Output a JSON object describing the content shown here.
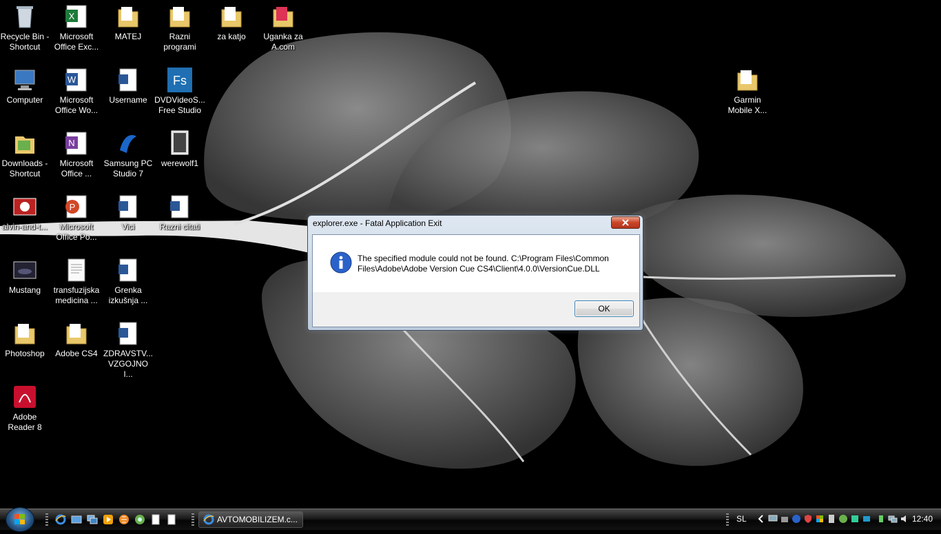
{
  "desktop": {
    "icons": [
      {
        "label": "Recycle Bin - Shortcut",
        "icon": "recycle-bin-icon"
      },
      {
        "label": "Microsoft Office Exc...",
        "icon": "excel-icon"
      },
      {
        "label": "MATEJ",
        "icon": "folder-icon"
      },
      {
        "label": "Razni programi",
        "icon": "folder-icon"
      },
      {
        "label": "za katjo",
        "icon": "folder-icon"
      },
      {
        "label": "Uganka za A.com",
        "icon": "folder-icon"
      },
      {
        "label": "Computer",
        "icon": "computer-icon"
      },
      {
        "label": "Microsoft Office Wo...",
        "icon": "word-icon"
      },
      {
        "label": "Username",
        "icon": "document-icon"
      },
      {
        "label": "DVDVideoS... Free Studio",
        "icon": "dvdvideosoft-icon"
      },
      {
        "label": "Garmin Mobile X...",
        "icon": "folder-icon"
      },
      {
        "label": "Downloads - Shortcut",
        "icon": "downloads-folder-icon"
      },
      {
        "label": "Microsoft Office ...",
        "icon": "onenote-icon"
      },
      {
        "label": "Samsung PC Studio 7",
        "icon": "samsung-pc-studio-icon"
      },
      {
        "label": "werewolf1",
        "icon": "image-file-icon"
      },
      {
        "label": "alvin-and-t...",
        "icon": "image-file-icon"
      },
      {
        "label": "Microsoft Office Po...",
        "icon": "powerpoint-icon"
      },
      {
        "label": "Vici",
        "icon": "document-icon"
      },
      {
        "label": "Razni citati",
        "icon": "document-icon"
      },
      {
        "label": "Mustang",
        "icon": "image-file-icon"
      },
      {
        "label": "transfuzijska medicina ...",
        "icon": "text-file-icon"
      },
      {
        "label": "Grenka izkušnja ...",
        "icon": "document-icon"
      },
      {
        "label": "Photoshop",
        "icon": "folder-icon"
      },
      {
        "label": "Adobe CS4",
        "icon": "folder-icon"
      },
      {
        "label": "ZDRAVSTV... VZGOJNO I...",
        "icon": "word-icon"
      },
      {
        "label": "Adobe Reader 8",
        "icon": "adobe-reader-icon"
      }
    ]
  },
  "dialog": {
    "title": "explorer.exe - Fatal Application Exit",
    "message": "The specified module could not be found. C:\\Program Files\\Common Files\\Adobe\\Adobe Version Cue CS4\\Client\\4.0.0\\VersionCue.DLL",
    "ok_label": "OK",
    "icon": "info-icon"
  },
  "taskbar": {
    "start_icon": "windows-logo-icon",
    "quick_launch": [
      "internet-explorer-icon",
      "show-desktop-icon",
      "switch-windows-icon",
      "media-player-icon",
      "vlc-icon",
      "app-icon",
      "document-icon",
      "document-icon"
    ],
    "task_button_label": "AVTOMOBILIZEM.c...",
    "language": "SL",
    "clock": "12:40"
  },
  "colors": {
    "dialog_frame": "#bccbdc",
    "close_button": "#c9452a",
    "ok_border": "#3c7fb1",
    "taskbar": "#111111"
  }
}
